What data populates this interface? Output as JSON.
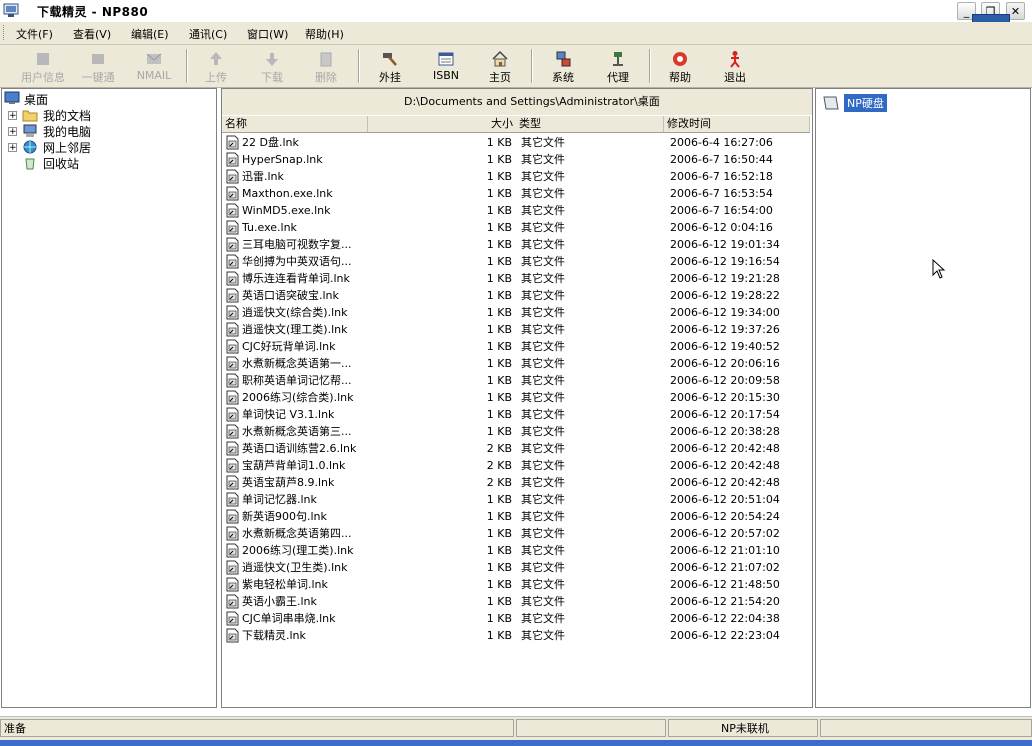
{
  "window": {
    "title": "下载精灵 - NP880",
    "minimize_label": "_",
    "restore_label": "❐",
    "close_label": "✕"
  },
  "menu": [
    "文件(F)",
    "查看(V)",
    "编辑(E)",
    "通讯(C)",
    "窗口(W)",
    "帮助(H)"
  ],
  "toolbar": {
    "buttons": [
      {
        "label": "用户信息",
        "icon": "user-info-icon",
        "enabled": false
      },
      {
        "label": "一键通",
        "icon": "one-key-icon",
        "enabled": false
      },
      {
        "label": "NMAIL",
        "icon": "mail-icon",
        "enabled": false
      },
      {
        "label": "上传",
        "icon": "upload-icon",
        "enabled": false
      },
      {
        "label": "下载",
        "icon": "download-icon",
        "enabled": false
      },
      {
        "label": "删除",
        "icon": "delete-icon",
        "enabled": false
      },
      {
        "label": "外挂",
        "icon": "hammer-icon",
        "enabled": true
      },
      {
        "label": "ISBN",
        "icon": "isbn-icon",
        "enabled": true
      },
      {
        "label": "主页",
        "icon": "home-icon",
        "enabled": true
      },
      {
        "label": "系统",
        "icon": "system-icon",
        "enabled": true
      },
      {
        "label": "代理",
        "icon": "proxy-icon",
        "enabled": true
      },
      {
        "label": "帮助",
        "icon": "help-icon",
        "enabled": true
      },
      {
        "label": "退出",
        "icon": "exit-icon",
        "enabled": true
      }
    ]
  },
  "tree": {
    "root": "桌面",
    "items": [
      "我的文档",
      "我的电脑",
      "网上邻居",
      "回收站"
    ]
  },
  "filelist": {
    "path": "D:\\Documents and Settings\\Administrator\\桌面",
    "columns": {
      "name": "名称",
      "size": "大小",
      "type": "类型",
      "modified": "修改时间"
    },
    "rows": [
      {
        "name": "22 D盘.lnk",
        "size": "1 KB",
        "type": "其它文件",
        "modified": "2006-6-4 16:27:06"
      },
      {
        "name": "HyperSnap.lnk",
        "size": "1 KB",
        "type": "其它文件",
        "modified": "2006-6-7 16:50:44"
      },
      {
        "name": "迅雷.lnk",
        "size": "1 KB",
        "type": "其它文件",
        "modified": "2006-6-7 16:52:18"
      },
      {
        "name": "Maxthon.exe.lnk",
        "size": "1 KB",
        "type": "其它文件",
        "modified": "2006-6-7 16:53:54"
      },
      {
        "name": "WinMD5.exe.lnk",
        "size": "1 KB",
        "type": "其它文件",
        "modified": "2006-6-7 16:54:00"
      },
      {
        "name": "Tu.exe.lnk",
        "size": "1 KB",
        "type": "其它文件",
        "modified": "2006-6-12 0:04:16"
      },
      {
        "name": "三耳电脑可视数字复...",
        "size": "1 KB",
        "type": "其它文件",
        "modified": "2006-6-12 19:01:34"
      },
      {
        "name": "华创搏为中英双语句...",
        "size": "1 KB",
        "type": "其它文件",
        "modified": "2006-6-12 19:16:54"
      },
      {
        "name": "博乐连连看背单词.lnk",
        "size": "1 KB",
        "type": "其它文件",
        "modified": "2006-6-12 19:21:28"
      },
      {
        "name": "英语口语突破宝.lnk",
        "size": "1 KB",
        "type": "其它文件",
        "modified": "2006-6-12 19:28:22"
      },
      {
        "name": "逍遥快文(综合类).lnk",
        "size": "1 KB",
        "type": "其它文件",
        "modified": "2006-6-12 19:34:00"
      },
      {
        "name": "逍遥快文(理工类).lnk",
        "size": "1 KB",
        "type": "其它文件",
        "modified": "2006-6-12 19:37:26"
      },
      {
        "name": "CJC好玩背单词.lnk",
        "size": "1 KB",
        "type": "其它文件",
        "modified": "2006-6-12 19:40:52"
      },
      {
        "name": "水煮新概念英语第一...",
        "size": "1 KB",
        "type": "其它文件",
        "modified": "2006-6-12 20:06:16"
      },
      {
        "name": "职称英语单词记忆帮...",
        "size": "1 KB",
        "type": "其它文件",
        "modified": "2006-6-12 20:09:58"
      },
      {
        "name": "2006练习(综合类).lnk",
        "size": "1 KB",
        "type": "其它文件",
        "modified": "2006-6-12 20:15:30"
      },
      {
        "name": "单词快记 V3.1.lnk",
        "size": "1 KB",
        "type": "其它文件",
        "modified": "2006-6-12 20:17:54"
      },
      {
        "name": "水煮新概念英语第三...",
        "size": "1 KB",
        "type": "其它文件",
        "modified": "2006-6-12 20:38:28"
      },
      {
        "name": "英语口语训练营2.6.lnk",
        "size": "2 KB",
        "type": "其它文件",
        "modified": "2006-6-12 20:42:48"
      },
      {
        "name": "宝葫芦背单词1.0.lnk",
        "size": "2 KB",
        "type": "其它文件",
        "modified": "2006-6-12 20:42:48"
      },
      {
        "name": "英语宝葫芦8.9.lnk",
        "size": "2 KB",
        "type": "其它文件",
        "modified": "2006-6-12 20:42:48"
      },
      {
        "name": "单词记忆器.lnk",
        "size": "1 KB",
        "type": "其它文件",
        "modified": "2006-6-12 20:51:04"
      },
      {
        "name": "新英语900句.lnk",
        "size": "1 KB",
        "type": "其它文件",
        "modified": "2006-6-12 20:54:24"
      },
      {
        "name": "水煮新概念英语第四...",
        "size": "1 KB",
        "type": "其它文件",
        "modified": "2006-6-12 20:57:02"
      },
      {
        "name": "2006练习(理工类).lnk",
        "size": "1 KB",
        "type": "其它文件",
        "modified": "2006-6-12 21:01:10"
      },
      {
        "name": "逍遥快文(卫生类).lnk",
        "size": "1 KB",
        "type": "其它文件",
        "modified": "2006-6-12 21:07:02"
      },
      {
        "name": "紫电轻松单词.lnk",
        "size": "1 KB",
        "type": "其它文件",
        "modified": "2006-6-12 21:48:50"
      },
      {
        "name": "英语小霸王.lnk",
        "size": "1 KB",
        "type": "其它文件",
        "modified": "2006-6-12 21:54:20"
      },
      {
        "name": "CJC单词串串烧.lnk",
        "size": "1 KB",
        "type": "其它文件",
        "modified": "2006-6-12 22:04:38"
      },
      {
        "name": "下载精灵.lnk",
        "size": "1 KB",
        "type": "其它文件",
        "modified": "2006-6-12 22:23:04"
      }
    ]
  },
  "device": {
    "label": "NP硬盘"
  },
  "status": {
    "ready": "准备",
    "connection": "NP未联机"
  },
  "colors": {
    "chrome": "#ece9d8",
    "selection": "#316ac5",
    "border": "#808080"
  }
}
